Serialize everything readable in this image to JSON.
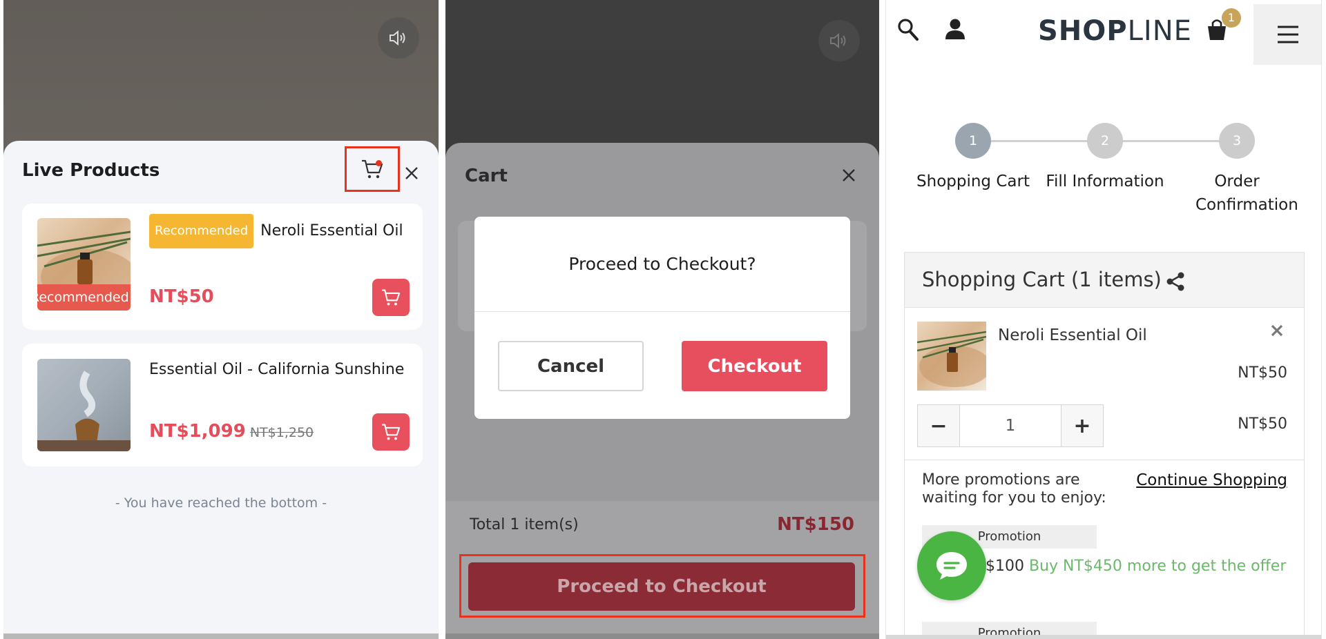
{
  "panel1": {
    "title": "Live Products",
    "products": [
      {
        "badge": "Recommended",
        "name": "Neroli Essential Oil",
        "thumb_label": "Recommended Product",
        "price": "NT$50"
      },
      {
        "name": "Essential Oil - California Sunshine",
        "price": "NT$1,099",
        "old_price": "NT$1,250"
      }
    ],
    "bottom_note": "- You have reached the bottom -"
  },
  "panel2": {
    "title": "Cart",
    "dialog": {
      "message": "Proceed to Checkout?",
      "cancel": "Cancel",
      "confirm": "Checkout"
    },
    "total_label": "Total 1 item(s)",
    "total_value": "NT$150",
    "proceed": "Proceed to Checkout"
  },
  "panel3": {
    "logo_bold": "SHOP",
    "logo_light": "LINE",
    "cart_count": "1",
    "steps": [
      {
        "num": "1",
        "label": "Shopping Cart"
      },
      {
        "num": "2",
        "label": "Fill Information"
      },
      {
        "num": "3",
        "label": "Order Confirmation"
      }
    ],
    "cart_title": "Shopping Cart  (1 items)",
    "item": {
      "name": "Neroli Essential Oil",
      "unit_price": "NT$50",
      "quantity": "1",
      "total": "NT$50"
    },
    "promo_intro": "More promotions are waiting for you to enjoy:",
    "continue_shopping": "Continue Shopping",
    "promo_tag": "Promotion",
    "promo_text": "$500 折 $100",
    "promo_hint": "Buy NT$450 more to get the offer",
    "promo_tag2": "Promotion"
  },
  "colors": {
    "accent_red": "#e8505e",
    "highlight_border": "#e8321e",
    "badge_yellow": "#f5b731",
    "promo_green": "#6bb86b",
    "chat_green": "#4bb543"
  }
}
